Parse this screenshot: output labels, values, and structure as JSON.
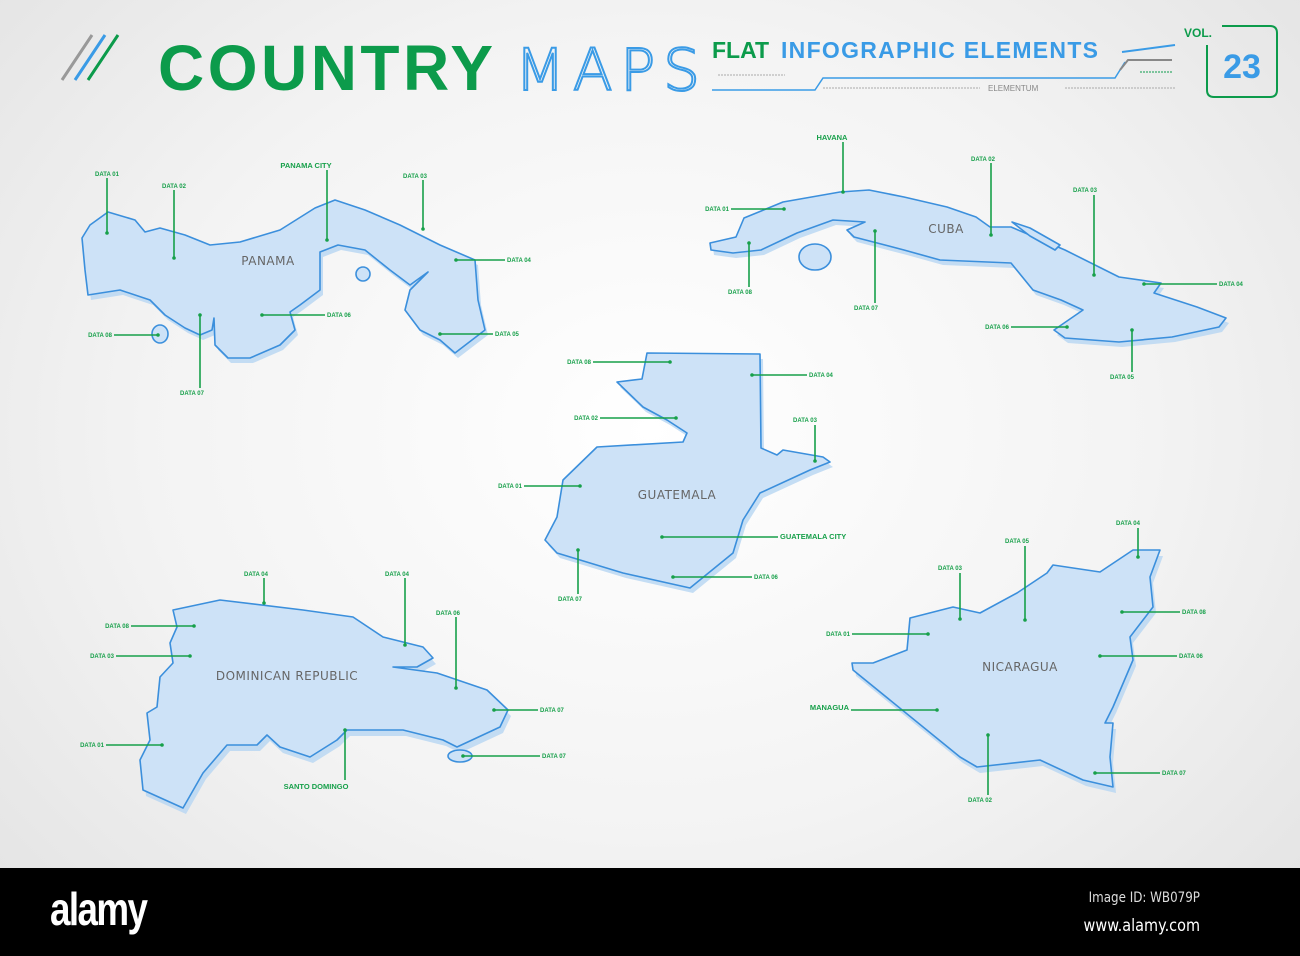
{
  "header": {
    "title_part1": "COUNTRY",
    "title_part2": "MAPS",
    "subtitle_part1": "FLAT",
    "subtitle_part2": "INFOGRAPHIC ELEMENTS",
    "brand": "ELEMENTUM",
    "vol_label": "VOL.",
    "vol_number": "23"
  },
  "colors": {
    "green": "#0c9b4b",
    "blue": "#3a9be6",
    "map_fill": "#cde2f7",
    "map_stroke": "#3b8fdc"
  },
  "maps": {
    "panama": {
      "name": "PANAMA",
      "callouts": [
        "DATA 01",
        "DATA 02",
        "PANAMA CITY",
        "DATA 03",
        "DATA 04",
        "DATA 05",
        "DATA 06",
        "DATA 07",
        "DATA 08"
      ]
    },
    "cuba": {
      "name": "CUBA",
      "callouts": [
        "HAVANA",
        "DATA 01",
        "DATA 02",
        "DATA 03",
        "DATA 04",
        "DATA 05",
        "DATA 06",
        "DATA 07",
        "DATA 08"
      ]
    },
    "guatemala": {
      "name": "GUATEMALA",
      "callouts": [
        "DATA 08",
        "DATA 04",
        "DATA 02",
        "DATA 03",
        "DATA 01",
        "GUATEMALA CITY",
        "DATA 06",
        "DATA 07"
      ]
    },
    "dominican_republic": {
      "name": "DOMINICAN REPUBLIC",
      "callouts": [
        "DATA 04",
        "DATA 04",
        "DATA 06",
        "DATA 08",
        "DATA 03",
        "DATA 01",
        "DATA 07",
        "DATA 07",
        "SANTO DOMINGO"
      ]
    },
    "nicaragua": {
      "name": "NICARAGUA",
      "callouts": [
        "DATA 04",
        "DATA 05",
        "DATA 03",
        "DATA 01",
        "DATA 08",
        "DATA 06",
        "MANAGUA",
        "DATA 07",
        "DATA 02"
      ]
    }
  },
  "footer": {
    "logo": "alamy",
    "image_id": "Image ID: WB079P",
    "url": "www.alamy.com"
  }
}
